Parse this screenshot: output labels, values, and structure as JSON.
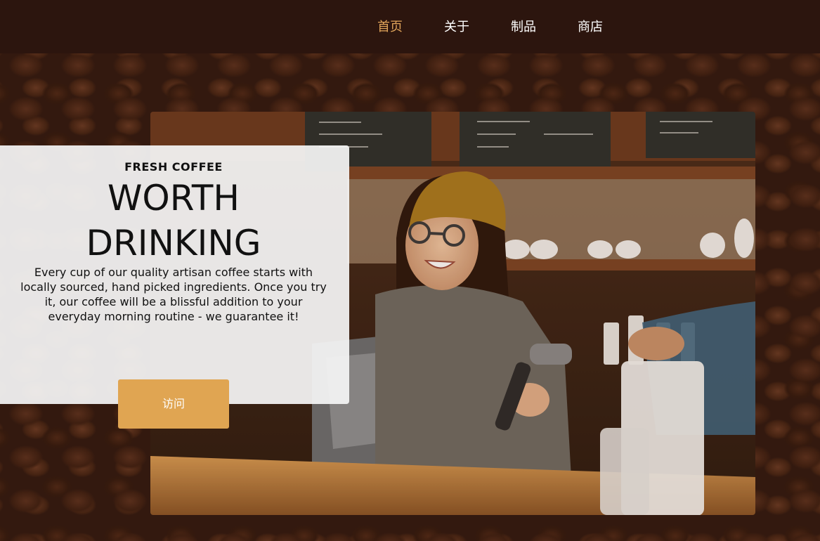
{
  "nav": {
    "items": [
      {
        "label": "首页",
        "active": true
      },
      {
        "label": "关于",
        "active": false
      },
      {
        "label": "制品",
        "active": false
      },
      {
        "label": "商店",
        "active": false
      }
    ]
  },
  "intro": {
    "subheading": "FRESH COFFEE",
    "title_line1": "WORTH",
    "title_line2": "DRINKING",
    "text": "Every cup of our quality artisan coffee starts with locally sourced, hand picked ingredients. Once you try it, our coffee will be a blissful addition to your everyday morning routine - we guarantee it!",
    "button_label": "访问"
  },
  "colors": {
    "accent": "#e0a552",
    "nav_active": "#e0a45a",
    "header_bg": "#2c150e"
  }
}
